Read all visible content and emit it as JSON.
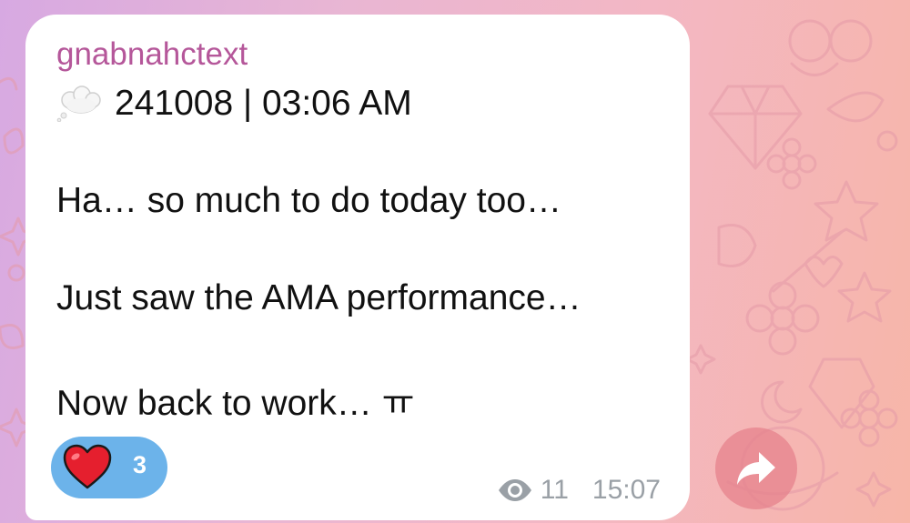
{
  "message": {
    "sender": "gnabnahctext",
    "header_text": "241008 | 03:06 AM",
    "header_icon": "thought-cloud-icon",
    "lines": [
      "Ha… so much to do today too…",
      "Just saw the AMA performance…",
      "Now back to work… ㅠ"
    ],
    "reaction": {
      "icon": "heart-icon",
      "count": "3",
      "color": "#6cb3ea"
    },
    "views": "11",
    "time": "15:07"
  },
  "actions": {
    "share_icon": "share-arrow-icon"
  },
  "colors": {
    "sender": "#b5579a",
    "background_start": "#d7a9e2",
    "background_end": "#f7b6a8"
  }
}
